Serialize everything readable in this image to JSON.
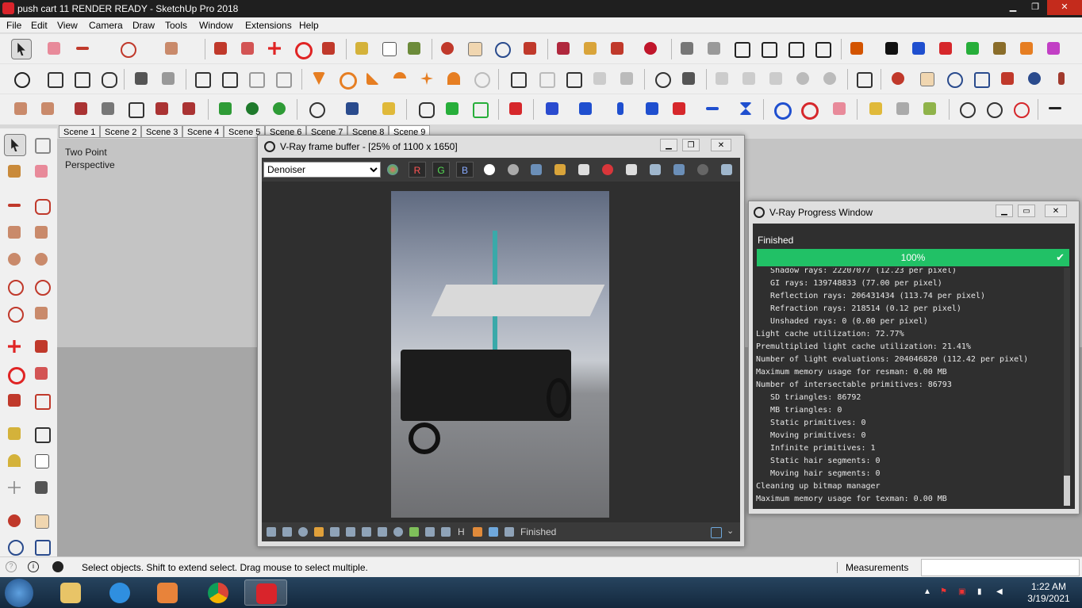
{
  "window": {
    "title": "push cart 11 RENDER READY - SketchUp Pro 2018",
    "minimize_label": "▁",
    "maximize_label": "❐",
    "close_label": "✕"
  },
  "menu": [
    "File",
    "Edit",
    "View",
    "Camera",
    "Draw",
    "Tools",
    "Window",
    "Extensions",
    "Help"
  ],
  "scenes": [
    "Scene 1",
    "Scene 2",
    "Scene 3",
    "Scene 4",
    "Scene 5",
    "Scene 6",
    "Scene 7",
    "Scene 8",
    "Scene 9"
  ],
  "viewport": {
    "camera_line1": "Two Point",
    "camera_line2": "Perspective"
  },
  "vfb": {
    "title": "V-Ray frame buffer - [25% of 1100 x 1650]",
    "channel": "Denoiser",
    "r": "R",
    "g": "G",
    "b": "B",
    "status": "Finished",
    "bottom_h": "H"
  },
  "progress": {
    "title": "V-Ray Progress Window",
    "status": "Finished",
    "percent": "100%",
    "percent_value": 100,
    "log": [
      "   Shadow rays: 22207077 (12.23 per pixel)",
      "   GI rays: 139748833 (77.00 per pixel)",
      "   Reflection rays: 206431434 (113.74 per pixel)",
      "   Refraction rays: 218514 (0.12 per pixel)",
      "   Unshaded rays: 0 (0.00 per pixel)",
      "Light cache utilization: 72.77%",
      "Premultiplied light cache utilization: 21.41%",
      "Number of light evaluations: 204046820 (112.42 per pixel)",
      "Maximum memory usage for resman: 0.00 MB",
      "Number of intersectable primitives: 86793",
      "   SD triangles: 86792",
      "   MB triangles: 0",
      "   Static primitives: 0",
      "   Moving primitives: 0",
      "   Infinite primitives: 1",
      "   Static hair segments: 0",
      "   Moving hair segments: 0",
      "Cleaning up bitmap manager",
      "Maximum memory usage for texman: 0.00 MB"
    ]
  },
  "statusbar": {
    "message": "Select objects. Shift to extend select. Drag mouse to select multiple.",
    "measurements_label": "Measurements",
    "measurements_value": ""
  },
  "taskbar": {
    "time": "1:22 AM",
    "date": "3/19/2021"
  },
  "colors": {
    "progress": "#21c166",
    "vfb_bg": "#2f2f2f",
    "titlebar": "#1f1f1f"
  }
}
